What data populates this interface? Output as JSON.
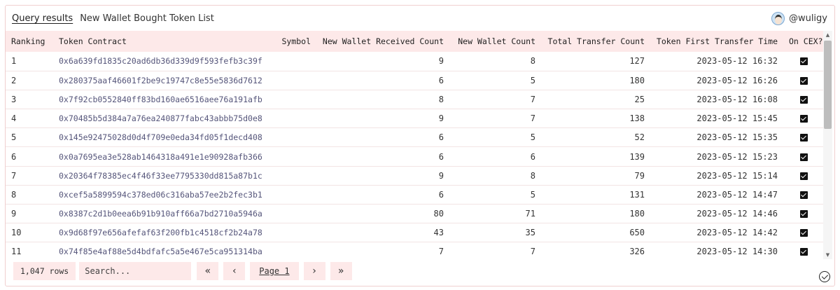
{
  "header": {
    "tab_label": "Query results",
    "query_title": "New Wallet Bought Token List",
    "author": "@wuligy"
  },
  "table": {
    "columns": {
      "ranking": "Ranking",
      "contract": "Token Contract",
      "symbol": "Symbol",
      "received": "New Wallet Received Count",
      "wallets": "New Wallet Count",
      "transfers": "Total Transfer Count",
      "first_time": "Token First Transfer Time",
      "on_cex": "On CEX?"
    },
    "rows": [
      {
        "ranking": "1",
        "contract": "0x6a639fd1835c20ad6db36d339d9f593fefb3c39f",
        "symbol": "",
        "received": "9",
        "wallets": "8",
        "transfers": "127",
        "first_time": "2023-05-12 16:32",
        "on_cex": true
      },
      {
        "ranking": "2",
        "contract": "0x280375aaf46601f2be9c19747c8e55e5836d7612",
        "symbol": "",
        "received": "6",
        "wallets": "5",
        "transfers": "180",
        "first_time": "2023-05-12 16:26",
        "on_cex": true
      },
      {
        "ranking": "3",
        "contract": "0x7f92cb0552840ff83bd160ae6516aee76a191afb",
        "symbol": "",
        "received": "8",
        "wallets": "7",
        "transfers": "25",
        "first_time": "2023-05-12 16:08",
        "on_cex": true
      },
      {
        "ranking": "4",
        "contract": "0x70485b5d384a7a76ea240877fabc43abbb75d0e8",
        "symbol": "",
        "received": "9",
        "wallets": "7",
        "transfers": "138",
        "first_time": "2023-05-12 15:45",
        "on_cex": true
      },
      {
        "ranking": "5",
        "contract": "0x145e92475028d0d4f709e0eda34fd05f1decd408",
        "symbol": "",
        "received": "6",
        "wallets": "5",
        "transfers": "52",
        "first_time": "2023-05-12 15:35",
        "on_cex": true
      },
      {
        "ranking": "6",
        "contract": "0x0a7695ea3e528ab1464318a491e1e90928afb366",
        "symbol": "",
        "received": "6",
        "wallets": "6",
        "transfers": "139",
        "first_time": "2023-05-12 15:23",
        "on_cex": true
      },
      {
        "ranking": "7",
        "contract": "0x20364f78385ec4f46f33ee7795330dd815a87b1c",
        "symbol": "",
        "received": "9",
        "wallets": "8",
        "transfers": "79",
        "first_time": "2023-05-12 15:14",
        "on_cex": true
      },
      {
        "ranking": "8",
        "contract": "0xcef5a5899594c378ed06c316aba57ee2b2fec3b1",
        "symbol": "",
        "received": "6",
        "wallets": "5",
        "transfers": "131",
        "first_time": "2023-05-12 14:47",
        "on_cex": true
      },
      {
        "ranking": "9",
        "contract": "0x8387c2d1b0eea6b91b910aff66a7bd2710a5946a",
        "symbol": "",
        "received": "80",
        "wallets": "71",
        "transfers": "180",
        "first_time": "2023-05-12 14:46",
        "on_cex": true
      },
      {
        "ranking": "10",
        "contract": "0x9d68f97e656afefaf63f200fb1c4518cf2b24a78",
        "symbol": "",
        "received": "43",
        "wallets": "35",
        "transfers": "650",
        "first_time": "2023-05-12 14:42",
        "on_cex": true
      },
      {
        "ranking": "11",
        "contract": "0x74f85e4af88e5d4bdfafc5a5e467e5ca951314ba",
        "symbol": "",
        "received": "7",
        "wallets": "7",
        "transfers": "326",
        "first_time": "2023-05-12 14:30",
        "on_cex": true
      }
    ]
  },
  "footer": {
    "rows_count": "1,047 rows",
    "search_placeholder": "Search...",
    "page_label": "Page 1"
  },
  "icons": {
    "first_page": "double-chevron-left-icon",
    "prev_page": "chevron-left-icon",
    "next_page": "chevron-right-icon",
    "last_page": "double-chevron-right-icon",
    "status": "check-circle-icon",
    "cex_flag": "checkbox-checked-icon"
  }
}
